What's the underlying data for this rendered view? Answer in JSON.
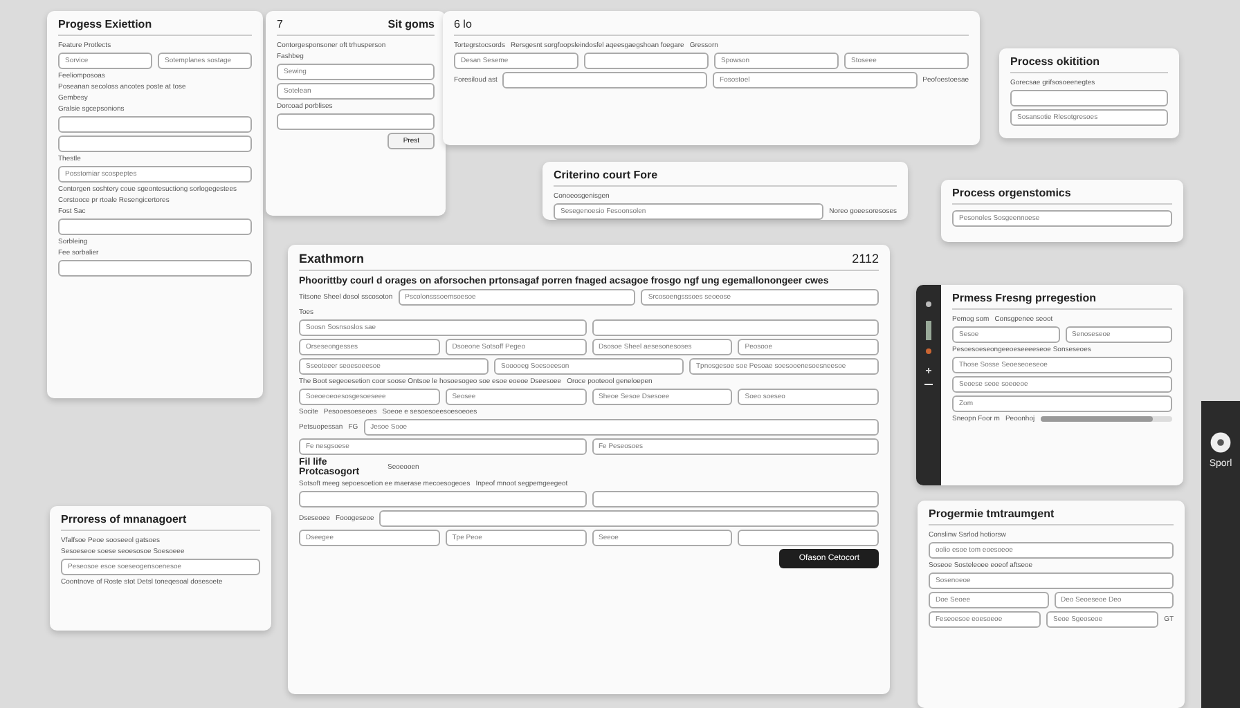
{
  "cards": [
    {
      "title": "Progess Exiettion",
      "rows": [
        [
          {
            "kind": "label",
            "text": "Feature Protlects"
          }
        ],
        [
          {
            "kind": "field",
            "text": "Sorvice"
          },
          {
            "kind": "field",
            "text": "Sotemplanes sostage"
          }
        ],
        [
          {
            "kind": "label",
            "text": "Feeliomposoas"
          }
        ],
        [
          {
            "kind": "label",
            "text": "Poseanan secoloss ancotes poste at tose"
          }
        ],
        [
          {
            "kind": "label",
            "text": "Gembesy"
          }
        ],
        [
          {
            "kind": "label",
            "text": "Gralsie sgcepsonions"
          }
        ],
        [
          {
            "kind": "field",
            "text": ""
          }
        ],
        [
          {
            "kind": "field",
            "text": ""
          }
        ],
        [
          {
            "kind": "label",
            "text": "Thestle"
          }
        ],
        [
          {
            "kind": "field",
            "text": "Posstomiar scospeptes"
          }
        ],
        [
          {
            "kind": "label",
            "text": "Contorgen soshtery coue sgeontesuctiong sorlogegestees"
          }
        ],
        [
          {
            "kind": "label",
            "text": "Corstooce pr rtoale Resengicertores"
          }
        ],
        [
          {
            "kind": "label",
            "text": "Fost Sac"
          }
        ],
        [
          {
            "kind": "field",
            "text": ""
          }
        ],
        [
          {
            "kind": "label",
            "text": "Sorbleing"
          }
        ],
        [
          {
            "kind": "label",
            "text": "Fee sorbalier"
          }
        ],
        [
          {
            "kind": "field",
            "text": ""
          }
        ]
      ]
    },
    {
      "title": "Sit goms",
      "number": "7",
      "rows": [
        [
          {
            "kind": "label",
            "text": "Contorgesponsoner oft trhusperson"
          }
        ],
        [
          {
            "kind": "label",
            "text": "Fashbeg"
          }
        ],
        [
          {
            "kind": "field",
            "text": "Sewing"
          }
        ],
        [
          {
            "kind": "field",
            "text": "Sotelean"
          }
        ],
        [
          {
            "kind": "label",
            "text": "Dorcoad porblises"
          }
        ],
        [
          {
            "kind": "field",
            "text": ""
          }
        ],
        [
          {
            "kind": "button",
            "text": "Prest"
          }
        ]
      ]
    },
    {
      "number": "6 lo",
      "rows": [
        [
          {
            "kind": "label",
            "text": "Tortegrstocsords"
          },
          {
            "kind": "label",
            "text": "Rersgesnt sorgfoopsleindosfel aqeesgaegshoan foegare"
          },
          {
            "kind": "label",
            "text": "Gressorn"
          }
        ],
        [
          {
            "kind": "field",
            "text": "Desan Seseme"
          },
          {
            "kind": "field",
            "text": ""
          },
          {
            "kind": "field",
            "text": "Spowson"
          },
          {
            "kind": "field",
            "text": "Stoseee"
          }
        ],
        [
          {
            "kind": "label",
            "text": "Foresiloud ast"
          },
          {
            "kind": "field",
            "text": ""
          },
          {
            "kind": "field",
            "text": "Fosostoel"
          },
          {
            "kind": "label",
            "text": "Peofoestoesae"
          }
        ]
      ]
    },
    {
      "title": "Process okitition",
      "rows": [
        [
          {
            "kind": "label",
            "text": "Gorecsae grifsosoeenegtes"
          }
        ],
        [
          {
            "kind": "field",
            "text": ""
          }
        ],
        [
          {
            "kind": "field",
            "text": "Sosansotie Rlesotgresoes"
          }
        ]
      ]
    },
    {
      "title": "Criterino court Fore",
      "rows": [
        [
          {
            "kind": "label",
            "text": "Conoeosgenisgen"
          }
        ],
        [
          {
            "kind": "field",
            "text": "Sesegenoesio Fesoonsolen"
          },
          {
            "kind": "label",
            "text": "Noreo goeesoresoses"
          }
        ]
      ]
    },
    {
      "title": "Process orgenstomics",
      "rows": [
        [
          {
            "kind": "field",
            "text": "Pesonoles Sosgeennoese"
          }
        ]
      ]
    },
    {
      "title": "Exathmorn",
      "number": "2112",
      "rows": [
        [
          {
            "kind": "heading",
            "text": "Phoorittby courl d orages on aforsochen prtonsagaf porren fnaged acsagoe frosgo ngf ung egemallonongeer cwes"
          }
        ],
        [
          {
            "kind": "label",
            "text": "Titsone Sheel dosol sscosoton"
          },
          {
            "kind": "field",
            "text": "Pscolonsssoemsoesoe"
          },
          {
            "kind": "field",
            "text": "Srcosoengsssoes seoeose"
          }
        ],
        [
          {
            "kind": "label",
            "text": "Toes"
          }
        ],
        [
          {
            "kind": "field",
            "text": "Soosn Sosnsoslos sae"
          },
          {
            "kind": "field",
            "text": ""
          }
        ],
        [
          {
            "kind": "field",
            "text": "Orseseongesses"
          },
          {
            "kind": "field",
            "text": "Dsoeone Sotsoff Pegeo"
          },
          {
            "kind": "field",
            "text": "Dsosoe Sheel aesesonesoses"
          },
          {
            "kind": "field",
            "text": "Peosooe"
          }
        ],
        [
          {
            "kind": "field",
            "text": "Sseoteeer seoesoeesoe"
          },
          {
            "kind": "field",
            "text": "Sooooeg Soesoeeson"
          },
          {
            "kind": "field",
            "text": "Tpnosgesoe soe Pesoae soesooenesoesneesoe"
          }
        ],
        [
          {
            "kind": "label",
            "text": "The Boot segeoesetion coor soose Ontsoe le hosoesogeo soe esoe eoeoe Dseesoee"
          },
          {
            "kind": "label",
            "text": "Oroce pooteool geneloepen"
          }
        ],
        [
          {
            "kind": "field",
            "text": "Soeoeoeoesosgesoeseee"
          },
          {
            "kind": "field",
            "text": "Seosee"
          },
          {
            "kind": "field",
            "text": "Sheoe Sesoe Dsesoee"
          },
          {
            "kind": "field",
            "text": "Soeo soeseo"
          }
        ],
        [
          {
            "kind": "label",
            "text": "Socite"
          },
          {
            "kind": "label",
            "text": "Pesooesoeseoes"
          },
          {
            "kind": "label",
            "text": "Soeoe e sesoesoeesoesoeoes"
          }
        ],
        [
          {
            "kind": "label",
            "text": "Petsuopessan"
          },
          {
            "kind": "label",
            "text": "FG"
          },
          {
            "kind": "field",
            "text": "Jesoe Sooe"
          }
        ],
        [
          {
            "kind": "field",
            "text": "Fe nesgsoese"
          },
          {
            "kind": "field",
            "text": "Fe Peseosoes"
          }
        ],
        [
          {
            "kind": "subheading",
            "text": "Fil life Protcasogort"
          },
          {
            "kind": "label",
            "text": "Seoeooen"
          }
        ],
        [
          {
            "kind": "label",
            "text": "Sotsoft meeg sepoesoetion ee maerase mecoesogeoes"
          },
          {
            "kind": "label",
            "text": "Inpeof mnoot segpemgeegeot"
          }
        ],
        [
          {
            "kind": "field",
            "text": ""
          },
          {
            "kind": "field",
            "text": ""
          }
        ],
        [
          {
            "kind": "label",
            "text": "Dseseoee"
          },
          {
            "kind": "label",
            "text": "Fooogeseoe"
          },
          {
            "kind": "field",
            "text": ""
          }
        ],
        [
          {
            "kind": "field",
            "text": "Dseegee"
          },
          {
            "kind": "field",
            "text": "Tpe   Peoe"
          },
          {
            "kind": "field",
            "text": "Seeoe"
          },
          {
            "kind": "field",
            "text": ""
          }
        ],
        [
          {
            "kind": "primary-button",
            "text": "Ofason Cetocort"
          }
        ]
      ]
    },
    {
      "title": "Prmess Fresng prregestion",
      "sidebar": true,
      "rows": [
        [
          {
            "kind": "label",
            "text": "Pemog som"
          },
          {
            "kind": "label",
            "text": "Consgpenee seoot"
          }
        ],
        [
          {
            "kind": "field",
            "text": "Sesoe"
          },
          {
            "kind": "field",
            "text": "Senoseseoe"
          }
        ],
        [
          {
            "kind": "label",
            "text": "Pesoesoeseongeeoeseeeeseoe Sonseseoes"
          }
        ],
        [
          {
            "kind": "field",
            "text": "Those Sosse Seoeseoeseoe"
          }
        ],
        [
          {
            "kind": "field",
            "text": "Seoese seoe soeoeoe"
          }
        ],
        [
          {
            "kind": "field",
            "text": "Zom"
          }
        ],
        [
          {
            "kind": "label",
            "text": "Sneopn Foor m"
          },
          {
            "kind": "meter",
            "text": "Peoonhoj",
            "level": 0.85
          }
        ]
      ]
    },
    {
      "title": "Prroress of mnanagoert",
      "rows": [
        [
          {
            "kind": "label",
            "text": "Vfalfsoe Peoe sooseeol gatsoes"
          }
        ],
        [
          {
            "kind": "label",
            "text": "Sesoeseoe soese seoesosoe Soesoeee"
          }
        ],
        [
          {
            "kind": "field",
            "text": "Peseosoe esoe soeseogensoenesoe"
          }
        ],
        [
          {
            "kind": "label",
            "text": "Coontnove of Roste stot Detsl toneqesoal dosesoete"
          }
        ]
      ]
    },
    {
      "title": "Progermie tmtraumgent",
      "rows": [
        [
          {
            "kind": "label",
            "text": "Conslinw Ssrlod hotiorsw"
          }
        ],
        [
          {
            "kind": "field",
            "text": "oolio esoe tom eoesoeoe"
          }
        ],
        [
          {
            "kind": "label",
            "text": "Soseoe Sosteleoee eoeof aftseoe"
          }
        ],
        [
          {
            "kind": "field",
            "text": "Sosenoeoe"
          }
        ],
        [
          {
            "kind": "field",
            "text": "Doe Seoee"
          },
          {
            "kind": "field",
            "text": "Deo Seoeseoe Deo"
          }
        ],
        [
          {
            "kind": "field",
            "text": "Feseoesoe eoesoeoe"
          },
          {
            "kind": "field",
            "text": "Seoe Sgeoseoe"
          },
          {
            "kind": "label",
            "text": "GT"
          }
        ]
      ]
    }
  ],
  "side_panel": {
    "label": "Sporl"
  }
}
